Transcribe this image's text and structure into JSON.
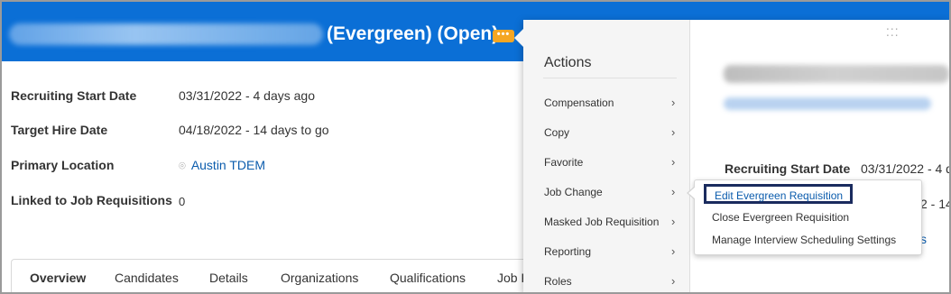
{
  "header": {
    "title_tags": "(Evergreen) (Open)",
    "related_actions_icon": "ellipsis-icon",
    "brand_color": "#0b6fd6",
    "related_actions_color": "#f5a623"
  },
  "details": {
    "rows": [
      {
        "label": "Recruiting Start Date",
        "value": "03/31/2022 - 4 days ago"
      },
      {
        "label": "Target Hire Date",
        "value": "04/18/2022 - 14 days to go"
      },
      {
        "label": "Primary Location",
        "value": "Austin TDEM"
      },
      {
        "label": "Linked to Job Requisitions",
        "value": "0"
      }
    ],
    "location_icon": "map-pin-icon"
  },
  "tabs": [
    "Overview",
    "Candidates",
    "Details",
    "Organizations",
    "Qualifications",
    "Job R"
  ],
  "actions_menu": {
    "title": "Actions",
    "items": [
      "Compensation",
      "Copy",
      "Favorite",
      "Job Change",
      "Masked Job Requisition",
      "Reporting",
      "Roles"
    ],
    "chevron_icon": "chevron-right-icon",
    "preview": {
      "label": "Recruiting Start Date",
      "value": "03/31/2022 - 4 d",
      "value2": "2 - 14",
      "value3": "s"
    }
  },
  "submenu": {
    "items": [
      "Edit Evergreen Requisition",
      "Close Evergreen Requisition",
      "Manage Interview Scheduling Settings"
    ]
  }
}
